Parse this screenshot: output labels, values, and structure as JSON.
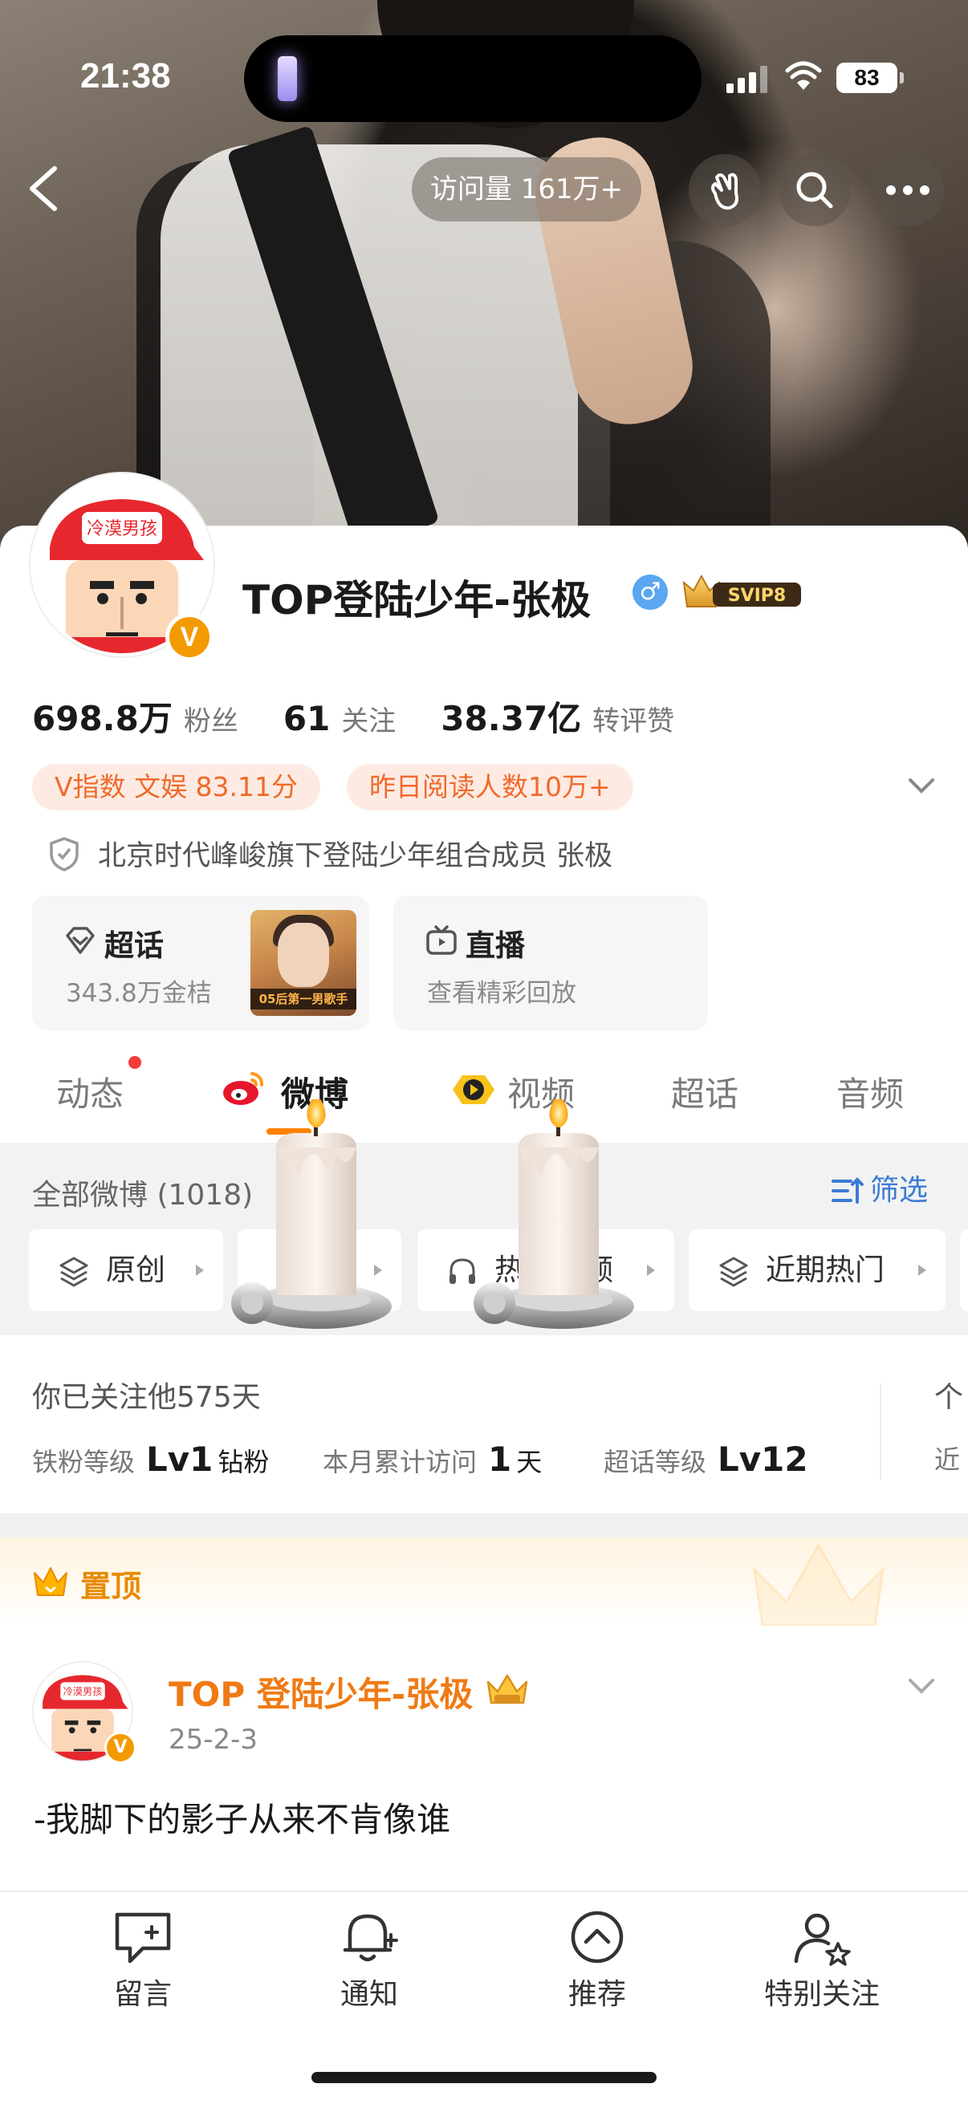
{
  "status_bar": {
    "time": "21:38",
    "battery": "83"
  },
  "nav": {
    "visits": "访问量 161万+"
  },
  "profile": {
    "name": "TOP登陆少年-张极",
    "avatar_text": "冷漠男孩",
    "svip": "SVIP8",
    "gender": "♂",
    "v": "V"
  },
  "stats": [
    {
      "value": "698.8万",
      "label": "粉丝"
    },
    {
      "value": "61",
      "label": "关注"
    },
    {
      "value": "38.37亿",
      "label": "转评赞"
    }
  ],
  "tags": [
    {
      "text": "V指数 文娱 83.11分"
    },
    {
      "text": "昨日阅读人数10万+"
    }
  ],
  "verification": "北京时代峰峻旗下登陆少年组合成员 张极",
  "features": {
    "chaohua": {
      "title": "超话",
      "sub": "343.8万金桔",
      "thumb_caption": "05后第一男歌手"
    },
    "live": {
      "title": "直播",
      "sub": "查看精彩回放"
    }
  },
  "tabs": [
    "动态",
    "微博",
    "视频",
    "超话",
    "音频"
  ],
  "filter": {
    "title": "全部微博 (1018)",
    "button": "筛选",
    "chips": [
      {
        "label": "原创"
      },
      {
        "label": ""
      },
      {
        "label": "热门视频"
      },
      {
        "label": "近期热门"
      }
    ]
  },
  "follow": {
    "title": "你已关注他575天",
    "partial_title": "个",
    "partial_row": "近",
    "iron_label": "铁粉等级",
    "iron_value": "Lv1",
    "iron_unit": "钻粉",
    "month_label": "本月累计访问",
    "month_value": "1",
    "month_unit": "天",
    "chaohua_label": "超话等级",
    "chaohua_value": "Lv12"
  },
  "pinned": {
    "label": "置顶"
  },
  "post": {
    "name": "TOP 登陆少年-张极",
    "date": "25-2-3",
    "text": "-我脚下的影子从来不肯像谁"
  },
  "bottom_nav": [
    "留言",
    "通知",
    "推荐",
    "特别关注"
  ],
  "colors": {
    "accent": "#ff8200",
    "pill_bg": "#fdebe3",
    "pill_text": "#f06a2b",
    "link_blue": "#3b7bd6",
    "gold": "#e98a00"
  }
}
